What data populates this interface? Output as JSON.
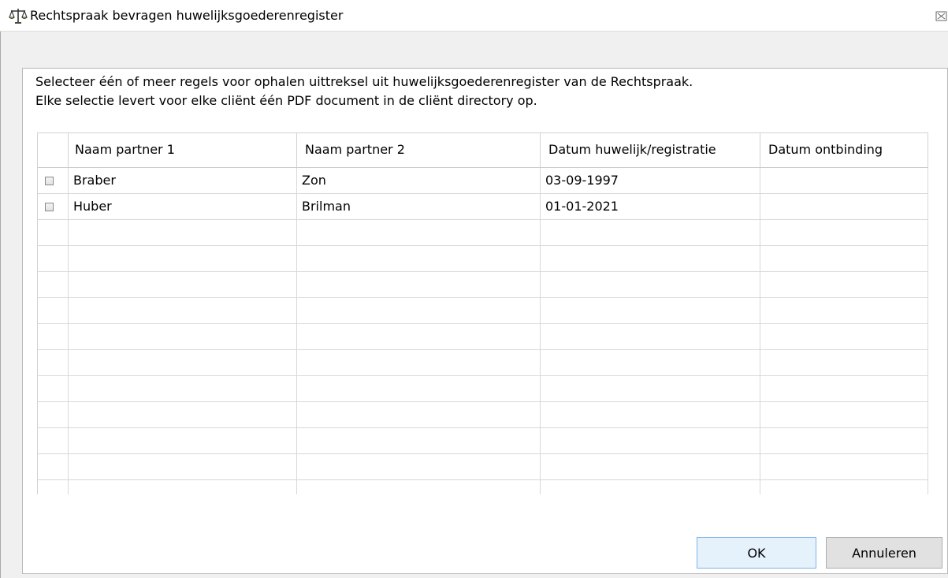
{
  "window": {
    "title": "Rechtspraak bevragen huwelijksgoederenregister",
    "title_icon": "scales-of-justice-icon",
    "close_icon": "close-icon"
  },
  "instructions": {
    "line1": "Selecteer één of meer regels voor ophalen uittreksel uit huwelijksgoederenregister van de Rechtspraak.",
    "line2": "Elke selectie levert voor elke cliënt één PDF document in de cliënt directory op."
  },
  "table": {
    "columns": [
      "",
      "Naam partner 1",
      "Naam partner 2",
      "Datum huwelijk/registratie",
      "Datum ontbinding"
    ],
    "rows": [
      {
        "checked": false,
        "partner1": "Braber",
        "partner2": "Zon",
        "date_marriage": "03-09-1997",
        "date_dissolution": ""
      },
      {
        "checked": false,
        "partner1": "Huber",
        "partner2": "Brilman",
        "date_marriage": "01-01-2021",
        "date_dissolution": ""
      },
      {
        "checked": false,
        "partner1": "",
        "partner2": "",
        "date_marriage": "",
        "date_dissolution": ""
      },
      {
        "checked": false,
        "partner1": "",
        "partner2": "",
        "date_marriage": "",
        "date_dissolution": ""
      },
      {
        "checked": false,
        "partner1": "",
        "partner2": "",
        "date_marriage": "",
        "date_dissolution": ""
      },
      {
        "checked": false,
        "partner1": "",
        "partner2": "",
        "date_marriage": "",
        "date_dissolution": ""
      },
      {
        "checked": false,
        "partner1": "",
        "partner2": "",
        "date_marriage": "",
        "date_dissolution": ""
      },
      {
        "checked": false,
        "partner1": "",
        "partner2": "",
        "date_marriage": "",
        "date_dissolution": ""
      },
      {
        "checked": false,
        "partner1": "",
        "partner2": "",
        "date_marriage": "",
        "date_dissolution": ""
      },
      {
        "checked": false,
        "partner1": "",
        "partner2": "",
        "date_marriage": "",
        "date_dissolution": ""
      },
      {
        "checked": false,
        "partner1": "",
        "partner2": "",
        "date_marriage": "",
        "date_dissolution": ""
      },
      {
        "checked": false,
        "partner1": "",
        "partner2": "",
        "date_marriage": "",
        "date_dissolution": ""
      },
      {
        "checked": false,
        "partner1": "",
        "partner2": "",
        "date_marriage": "",
        "date_dissolution": ""
      }
    ]
  },
  "buttons": {
    "ok": "OK",
    "cancel": "Annuleren"
  },
  "colors": {
    "dialog_background": "#f0f0f0",
    "default_button_border": "#7eb4ea"
  }
}
